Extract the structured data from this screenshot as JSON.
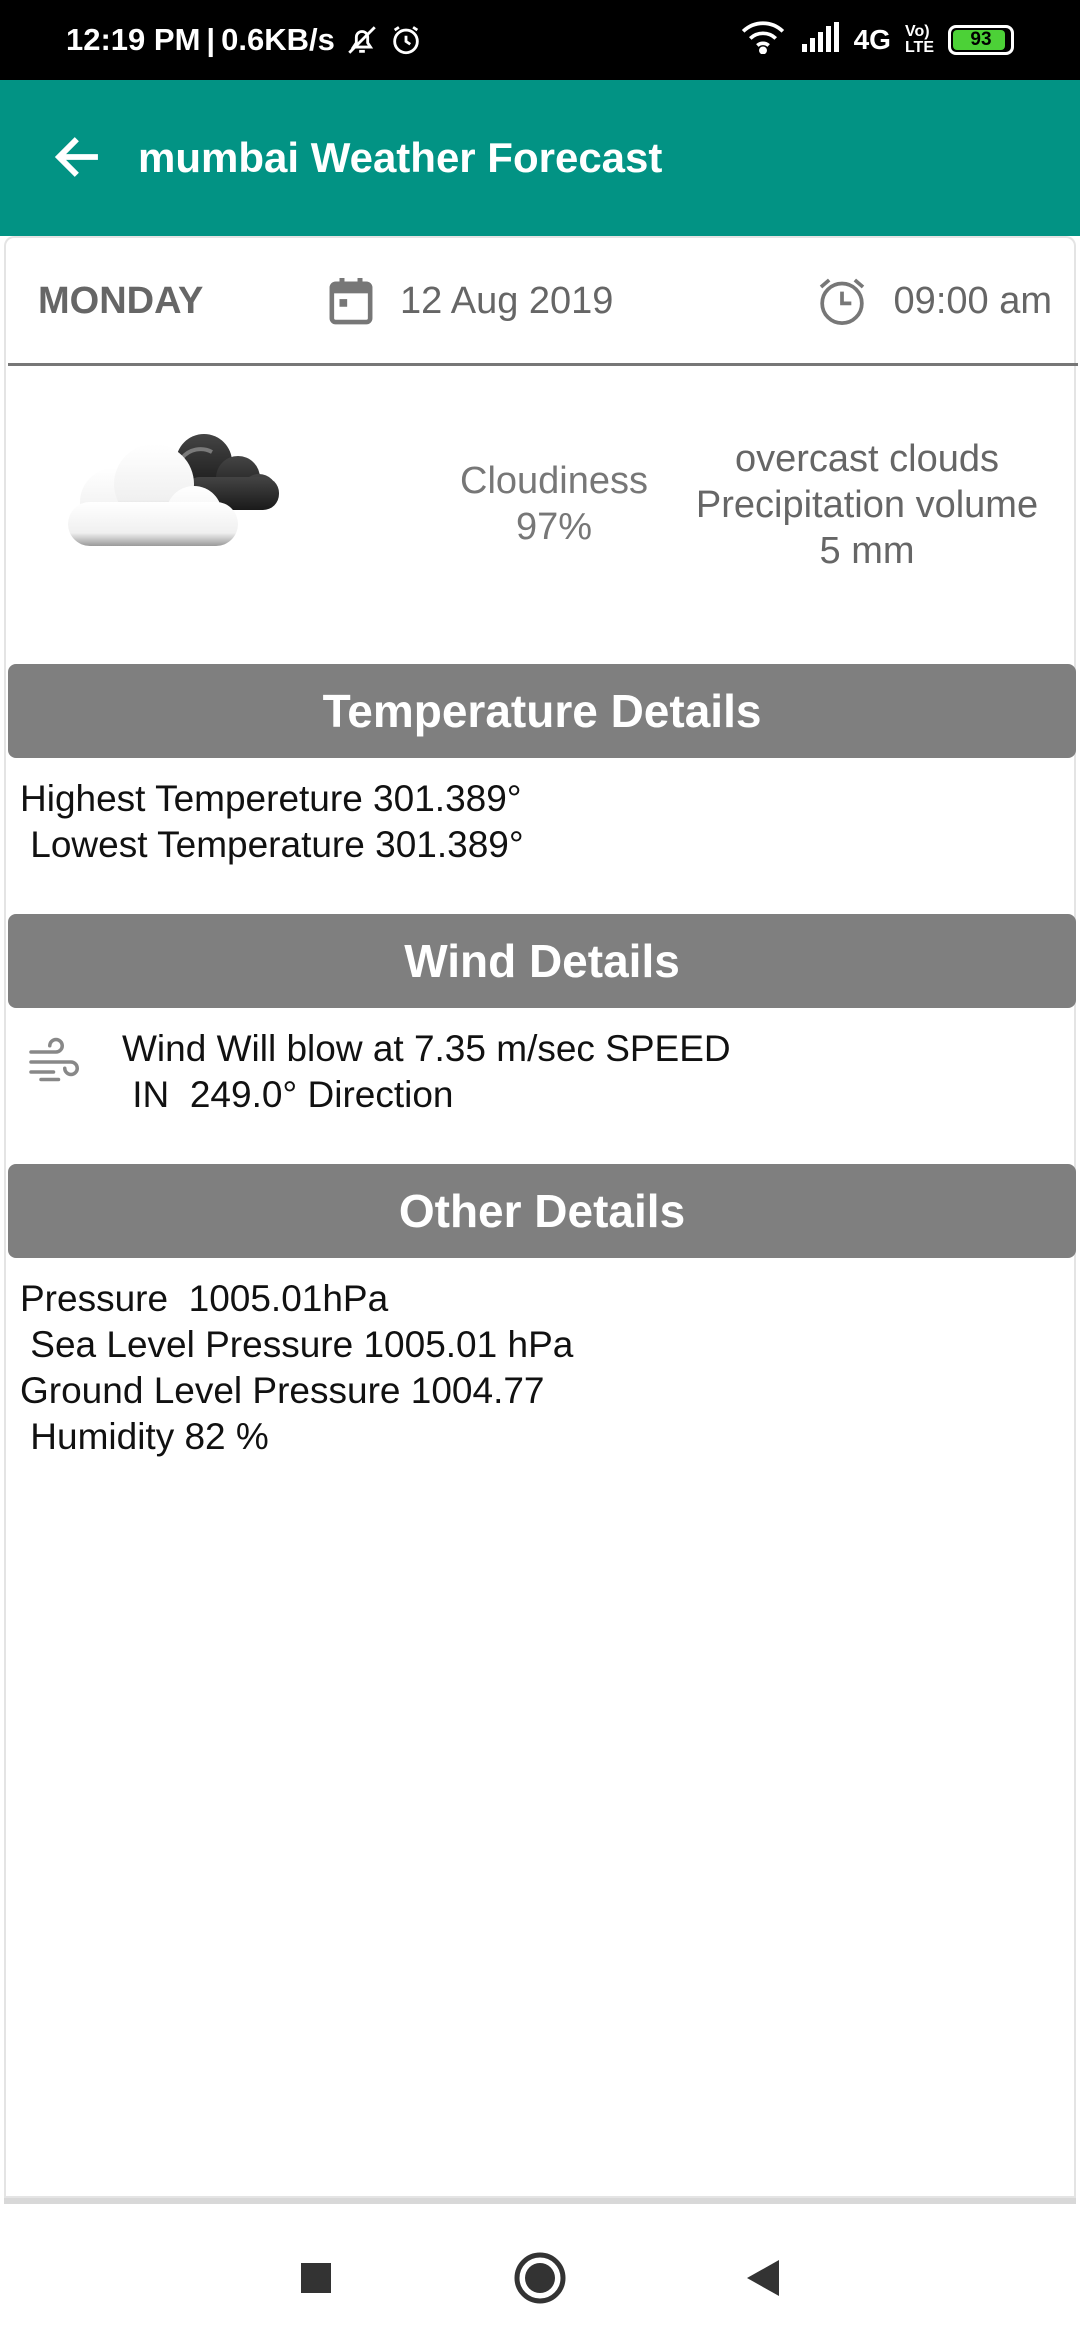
{
  "status_bar": {
    "time": "12:19 PM",
    "separator": "|",
    "speed": "0.6KB/s",
    "network": "4G",
    "lte_top": "Vo)",
    "lte_bottom": "LTE",
    "battery": "93",
    "battery_percent": 93
  },
  "app_bar": {
    "title": "mumbai Weather Forecast"
  },
  "forecast": {
    "day": "MONDAY",
    "date": "12 Aug 2019",
    "time": "09:00 am",
    "cloudiness_label": "Cloudiness",
    "cloudiness_value": "97%",
    "description": "overcast clouds",
    "precip_label": "Precipitation volume",
    "precip_value": "5 mm"
  },
  "temperature": {
    "header": "Temperature Details",
    "highest": "Highest Tempereture 301.389°",
    "lowest": " Lowest Temperature 301.389°"
  },
  "wind": {
    "header": "Wind Details",
    "line1": "Wind Will blow at 7.35 m/sec SPEED",
    "line2": " IN  249.0° Direction"
  },
  "other": {
    "header": "Other Details",
    "pressure": "Pressure  1005.01hPa",
    "sea_level": " Sea Level Pressure 1005.01 hPa",
    "ground_level": "Ground Level Pressure 1004.77",
    "humidity": " Humidity 82 %"
  },
  "colors": {
    "app_bar": "#029384",
    "section_header": "#7f7f7f",
    "status_bar": "#000000",
    "battery": "#4cd137"
  },
  "icons": {
    "back": "arrow-left-icon",
    "calendar": "calendar-icon",
    "alarm": "alarm-clock-icon",
    "weather": "cloud-icon",
    "wind": "wind-icon",
    "recent": "square-icon",
    "home": "circle-icon",
    "back_nav": "triangle-icon"
  }
}
